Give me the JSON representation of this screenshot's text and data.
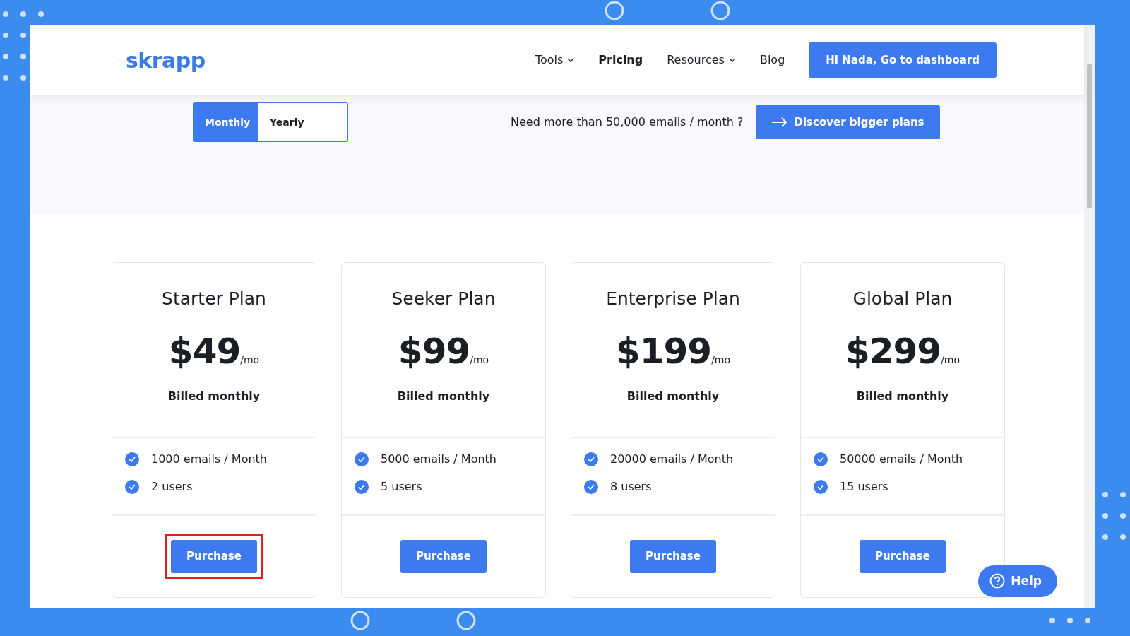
{
  "header": {
    "logo": "skrapp",
    "nav": [
      {
        "label": "Tools",
        "dropdown": true,
        "selected": false
      },
      {
        "label": "Pricing",
        "dropdown": false,
        "selected": true
      },
      {
        "label": "Resources",
        "dropdown": true,
        "selected": false
      },
      {
        "label": "Blog",
        "dropdown": false,
        "selected": false
      }
    ],
    "cta": "Hi Nada, Go to dashboard"
  },
  "billing_toggle": [
    {
      "label": "Monthly",
      "selected": true
    },
    {
      "label": "Yearly",
      "selected": false
    }
  ],
  "bigger_plans": {
    "text": "Need more than 50,000 emails / month ?",
    "button": "Discover bigger plans"
  },
  "plans": [
    {
      "name": "Starter Plan",
      "price": "$49",
      "unit": "/mo",
      "billing": "Billed monthly",
      "features": [
        "1000 emails / Month",
        "2 users"
      ],
      "button": "Purchase",
      "highlighted": true
    },
    {
      "name": "Seeker Plan",
      "price": "$99",
      "unit": "/mo",
      "billing": "Billed monthly",
      "features": [
        "5000 emails / Month",
        "5 users"
      ],
      "button": "Purchase",
      "highlighted": false
    },
    {
      "name": "Enterprise Plan",
      "price": "$199",
      "unit": "/mo",
      "billing": "Billed monthly",
      "features": [
        "20000 emails / Month",
        "8 users"
      ],
      "button": "Purchase",
      "highlighted": false
    },
    {
      "name": "Global Plan",
      "price": "$299",
      "unit": "/mo",
      "billing": "Billed monthly",
      "features": [
        "50000 emails / Month",
        "15 users"
      ],
      "button": "Purchase",
      "highlighted": false
    }
  ],
  "help_button": "Help"
}
